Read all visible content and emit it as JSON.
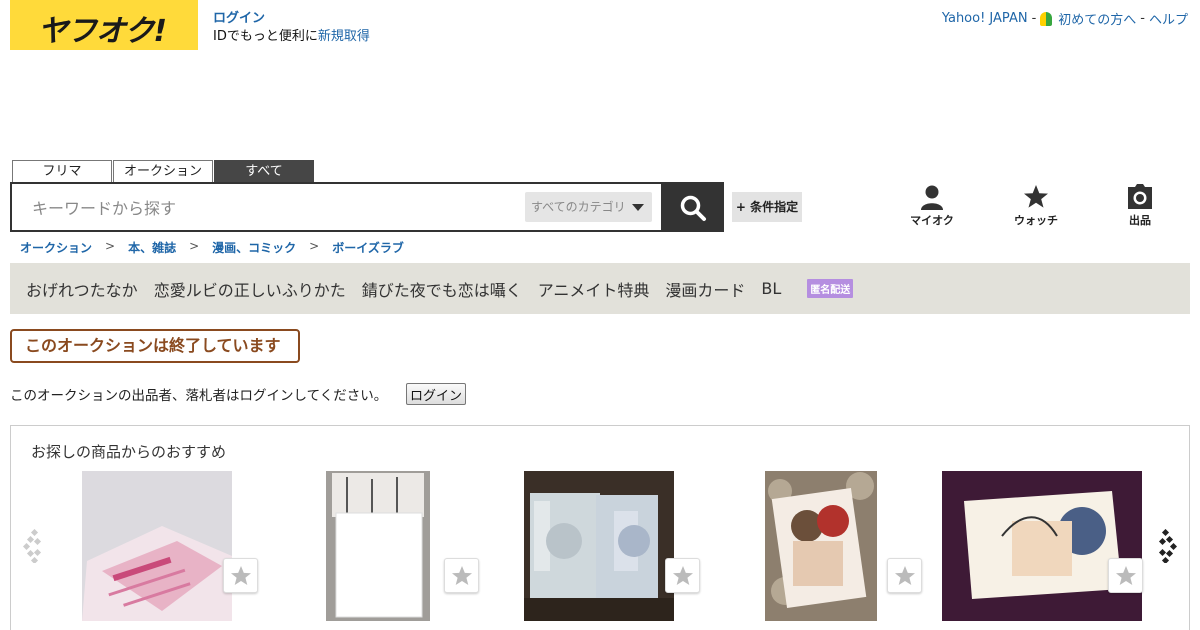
{
  "header": {
    "logo_text": "ヤフオク!",
    "login_label": "ログイン",
    "login_sub_prefix": "IDでもっと便利に",
    "register_label": "新規取得",
    "top_links": {
      "yahoo": "Yahoo! JAPAN",
      "first_time": "初めての方へ",
      "help": "ヘルプ",
      "separator": "-"
    }
  },
  "search": {
    "tabs": [
      "フリマ",
      "オークション",
      "すべて"
    ],
    "active_tab": "すべて",
    "placeholder": "キーワードから探す",
    "category_value": "すべてのカテゴリ",
    "condition_label": "+ 条件指定"
  },
  "nav": {
    "my_auction": "マイオク",
    "watch": "ウォッチ",
    "sell": "出品"
  },
  "breadcrumb": [
    "オークション",
    "本、雑誌",
    "漫画、コミック",
    "ボーイズラブ"
  ],
  "breadcrumb_separator": ">",
  "tags": [
    "おげれつたなか",
    "恋愛ルビの正しいふりかた",
    "錆びた夜でも恋は囁く",
    "アニメイト特典",
    "漫画カード",
    "BL"
  ],
  "anonymous_badge": "匿名配送",
  "auction_status": {
    "ended_label": "このオークションは終了しています",
    "message": "このオークションの出品者、落札者はログインしてください。",
    "login_button": "ログイン"
  },
  "recommend": {
    "title": "お探しの商品からのおすすめ"
  },
  "colors": {
    "brand_yellow": "#ffda3a",
    "link_blue": "#1f66a8",
    "ended_brown": "#8a4a1f",
    "anon_badge": "#b58ee0",
    "tag_bar_bg": "#e2e1da"
  }
}
